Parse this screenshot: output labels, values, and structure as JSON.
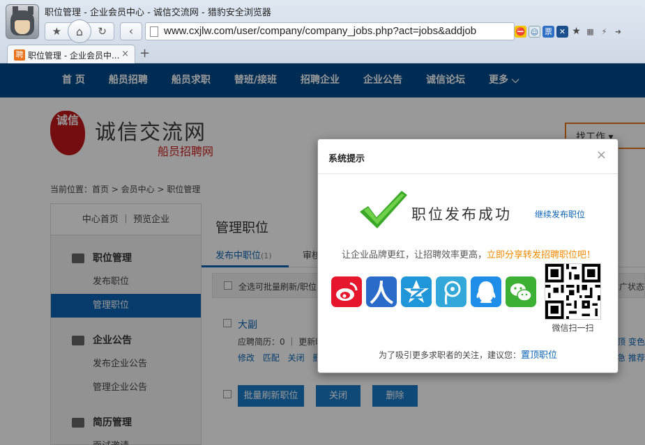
{
  "browser": {
    "window_title": "职位管理 - 企业会员中心 - 诚信交流网 - 猎豹安全浏览器",
    "url": "www.cxjlw.com/user/company/company_jobs.php?act=jobs&addjob",
    "tab_title": "职位管理 - 企业会员中...",
    "tab_favicon": "聘",
    "tab_close": "×",
    "new_tab": "+",
    "addr_icons": [
      "⛔",
      "☺",
      "票",
      "✕",
      "★",
      "▦",
      "⚡",
      "➜"
    ]
  },
  "site_nav": {
    "items": [
      "首 页",
      "船员招聘",
      "船员求职",
      "替班/接班",
      "招聘企业",
      "企业公告",
      "诚信论坛",
      "更多 ⌵"
    ]
  },
  "logo": {
    "seal_text": "诚信",
    "main": "诚信交流网",
    "sub": "船员招聘网"
  },
  "search": {
    "label": "找工作 ▾"
  },
  "breadcrumb": "当前位置：首页 > 会员中心 > 职位管理",
  "sidebar": {
    "top": "中心首页 ｜ 预览企业",
    "sections": [
      {
        "title": "职位管理",
        "links": [
          "发布职位",
          "管理职位"
        ]
      },
      {
        "title": "企业公告",
        "links": [
          "发布企业公告",
          "管理企业公告"
        ]
      },
      {
        "title": "简历管理",
        "links": [
          "面试邀请"
        ]
      }
    ]
  },
  "main": {
    "title": "管理职位",
    "tab_active": "发布中职位",
    "tab_active_count": "(1)",
    "tab_second": "审核",
    "toolbar_text": "全选可批量刷新/职位",
    "toolbar_right": "推广状态",
    "job": {
      "name": "大副",
      "meta": "应聘简历：0 ｜ 更新时",
      "actions": "修改 匹配 关闭 删",
      "right1": "顶 变色",
      "right2": "急 推荐"
    },
    "buttons": [
      "批量刷新职位",
      "关闭",
      "删除"
    ]
  },
  "modal": {
    "title": "系统提示",
    "close": "×",
    "success": "职位发布成功",
    "continue_link": "继续发布职位",
    "share_prefix": "让企业品牌更红，让招聘效率更高，",
    "share_highlight": "立即分享转发招聘职位吧！",
    "qr_label": "微信扫一扫",
    "tip_prefix": "为了吸引更多求职者的关注，建议您：",
    "tip_link": "置顶职位"
  },
  "colors": {
    "nav_blue": "#004a8b",
    "link_blue": "#0a63b3",
    "highlight_orange": "#f08a00",
    "button_blue": "#1a7ac9",
    "check_green": "#3aa827"
  }
}
